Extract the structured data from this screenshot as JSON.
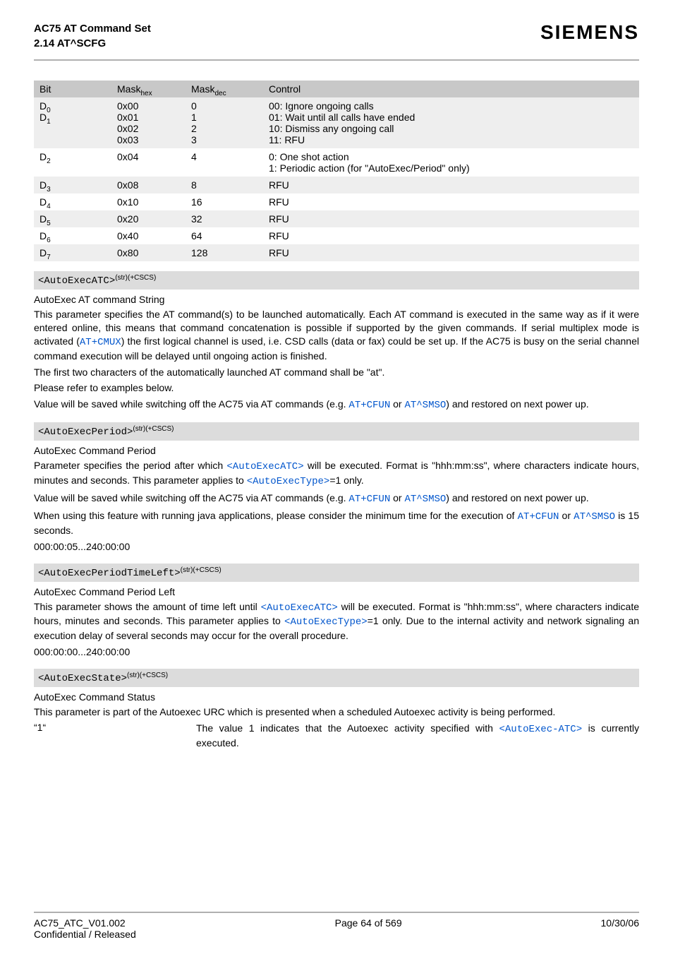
{
  "header": {
    "title_line1": "AC75 AT Command Set",
    "title_line2": "2.14 AT^SCFG",
    "brand": "SIEMENS"
  },
  "table": {
    "headers": {
      "bit": "Bit",
      "hex": "Mask",
      "hex_sub": "hex",
      "dec": "Mask",
      "dec_sub": "dec",
      "control": "Control"
    },
    "rows": [
      {
        "bit_html": "D<sub>0</sub><br>D<sub>1</sub>",
        "hex": "0x00\n0x01\n0x02\n0x03",
        "dec": "0\n1\n2\n3",
        "control": "00: Ignore ongoing calls\n01: Wait until all calls have ended\n10: Dismiss any ongoing call\n11: RFU"
      },
      {
        "bit_html": "D<sub>2</sub>",
        "hex": "0x04",
        "dec": "4",
        "control": "0: One shot action\n1: Periodic action (for \"AutoExec/Period\" only)"
      },
      {
        "bit_html": "D<sub>3</sub>",
        "hex": "0x08",
        "dec": "8",
        "control": "RFU"
      },
      {
        "bit_html": "D<sub>4</sub>",
        "hex": "0x10",
        "dec": "16",
        "control": "RFU"
      },
      {
        "bit_html": "D<sub>5</sub>",
        "hex": "0x20",
        "dec": "32",
        "control": "RFU"
      },
      {
        "bit_html": "D<sub>6</sub>",
        "hex": "0x40",
        "dec": "64",
        "control": "RFU"
      },
      {
        "bit_html": "D<sub>7</sub>",
        "hex": "0x80",
        "dec": "128",
        "control": "RFU"
      }
    ]
  },
  "params": {
    "atc": {
      "name": "<AutoExecATC>",
      "sup": "(str)(+CSCS)",
      "title": "AutoExec AT command String",
      "p1a": "This parameter specifies the AT command(s) to be launched automatically. Each AT command is executed in the same way as if it were entered online, this means that command concatenation is possible if supported by the given commands. If serial multiplex mode is activated (",
      "link1": "AT+CMUX",
      "p1b": ") the first logical channel is used, i.e. CSD calls (data or fax) could be set up. If the AC75 is busy on the serial channel command execution will be delayed until ongoing action is finished.",
      "p2": "The first two characters of the automatically launched AT command shall be \"at\".",
      "p3": "Please refer to examples below.",
      "p4a": "Value will be saved while switching off the AC75 via AT commands (e.g. ",
      "link2": "AT+CFUN",
      "or1": " or ",
      "link3": "AT^SMSO",
      "p4b": ") and restored on next power up."
    },
    "period": {
      "name": "<AutoExecPeriod>",
      "sup": "(str)(+CSCS)",
      "title": "AutoExec Command Period",
      "p1a": "Parameter specifies the period after which ",
      "link1": "<AutoExecATC>",
      "p1b": " will be executed. Format is \"hhh:mm:ss\", where characters indicate hours, minutes and seconds. This parameter applies to ",
      "link2": "<AutoExecType>",
      "p1c": "=1 only.",
      "p2a": "Value will be saved while switching off the AC75 via AT commands (e.g. ",
      "link3": "AT+CFUN",
      "or1": " or ",
      "link4": "AT^SMSO",
      "p2b": ") and restored on next power up.",
      "p3a": "When using this feature with running java applications, please consider the minimum time for the execution of ",
      "link5": "AT+CFUN",
      "or2": " or ",
      "link6": "AT^SMSO",
      "p3b": " is 15 seconds.",
      "range": "000:00:05...240:00:00"
    },
    "timeleft": {
      "name": "<AutoExecPeriodTimeLeft>",
      "sup": "(str)(+CSCS)",
      "title": "AutoExec Command Period Left",
      "p1a": "This parameter shows the amount of time left until ",
      "link1": "<AutoExecATC>",
      "p1b": " will be executed. Format is \"hhh:mm:ss\", where characters indicate hours, minutes and seconds. This parameter applies to ",
      "link2": "<AutoExecType>",
      "p1c": "=1 only. Due to the internal activity and network signaling an execution delay of several seconds may occur for the overall procedure.",
      "range": "000:00:00...240:00:00"
    },
    "state": {
      "name": "<AutoExecState>",
      "sup": "(str)(+CSCS)",
      "title": "AutoExec Command Status",
      "p1": "This parameter is part of the Autoexec URC which is presented when a scheduled Autoexec activity is being performed.",
      "val_key": "“1“",
      "val_desc_a": "The value 1 indicates that the Autoexec activity specified with ",
      "val_link": "<AutoExec-ATC>",
      "val_desc_b": " is currently executed."
    }
  },
  "footer": {
    "left1": "AC75_ATC_V01.002",
    "left2": "Confidential / Released",
    "mid": "Page 64 of 569",
    "right": "10/30/06"
  }
}
